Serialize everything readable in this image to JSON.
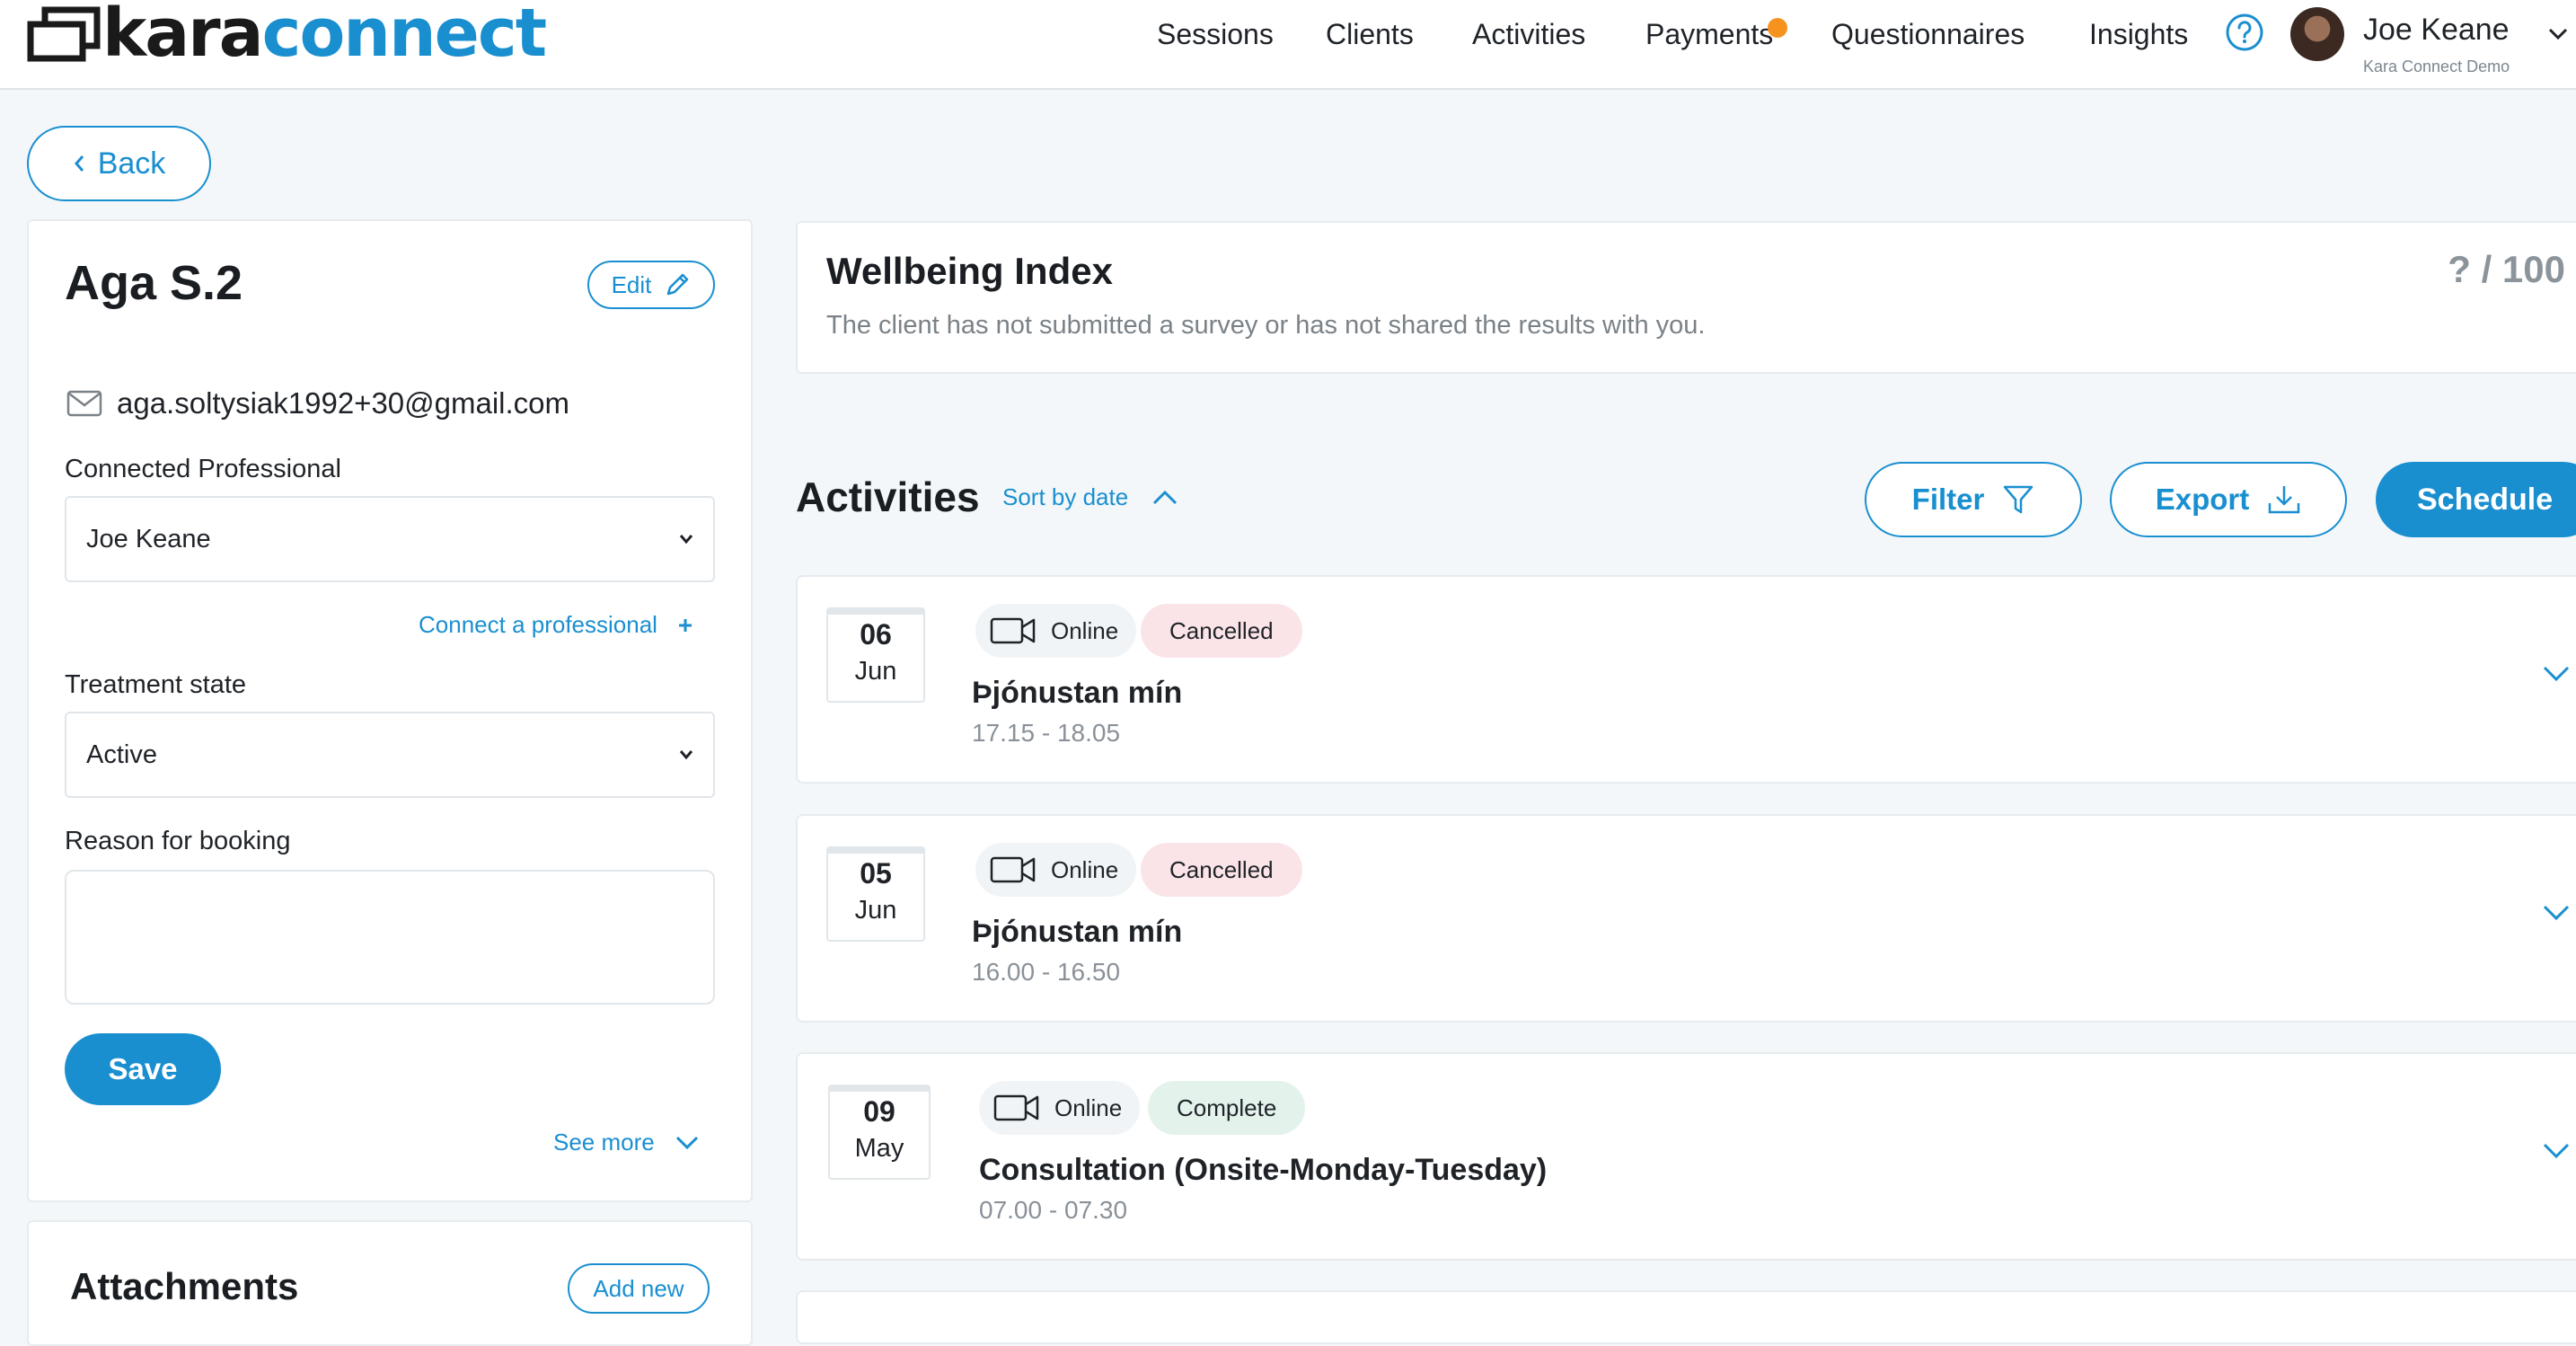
{
  "app": {
    "logo_part1": "kara",
    "logo_part2": "connect"
  },
  "nav": {
    "items": [
      {
        "label": "Sessions"
      },
      {
        "label": "Clients"
      },
      {
        "label": "Activities"
      },
      {
        "label": "Payments",
        "badge": true
      },
      {
        "label": "Questionnaires"
      },
      {
        "label": "Insights"
      }
    ],
    "help_icon": "help-circle-icon"
  },
  "user": {
    "name": "Joe Keane",
    "org": "Kara Connect Demo"
  },
  "back": {
    "label": "Back"
  },
  "client": {
    "name": "Aga S.2",
    "edit_label": "Edit",
    "email": "aga.soltysiak1992+30@gmail.com",
    "connected_professional_label": "Connected Professional",
    "connected_professional_value": "Joe Keane",
    "connect_link": "Connect a professional",
    "treatment_state_label": "Treatment state",
    "treatment_state_value": "Active",
    "reason_label": "Reason for booking",
    "reason_value": "",
    "save_label": "Save",
    "see_more": "See more"
  },
  "attachments": {
    "title": "Attachments",
    "add_new": "Add new"
  },
  "wellbeing": {
    "title": "Wellbeing Index",
    "score": "? / 100",
    "description": "The client has not submitted a survey or has not shared the results with you."
  },
  "activities": {
    "title": "Activities",
    "sort_label": "Sort by date",
    "filter_label": "Filter",
    "export_label": "Export",
    "schedule_label": "Schedule",
    "items": [
      {
        "day": "06",
        "month": "Jun",
        "mode": "Online",
        "status": "Cancelled",
        "name": "Þjónustan mín",
        "time": "17.15 - 18.05"
      },
      {
        "day": "05",
        "month": "Jun",
        "mode": "Online",
        "status": "Cancelled",
        "name": "Þjónustan mín",
        "time": "16.00 - 16.50"
      },
      {
        "day": "09",
        "month": "May",
        "mode": "Online",
        "status": "Complete",
        "name": "Consultation (Onsite-Monday-Tuesday)",
        "time": "07.00 - 07.30"
      }
    ]
  },
  "colors": {
    "accent": "#1a8fd0",
    "cancelled_bg": "#fbe4e8",
    "complete_bg": "#e3f3ec",
    "badge": "#f5931e"
  }
}
